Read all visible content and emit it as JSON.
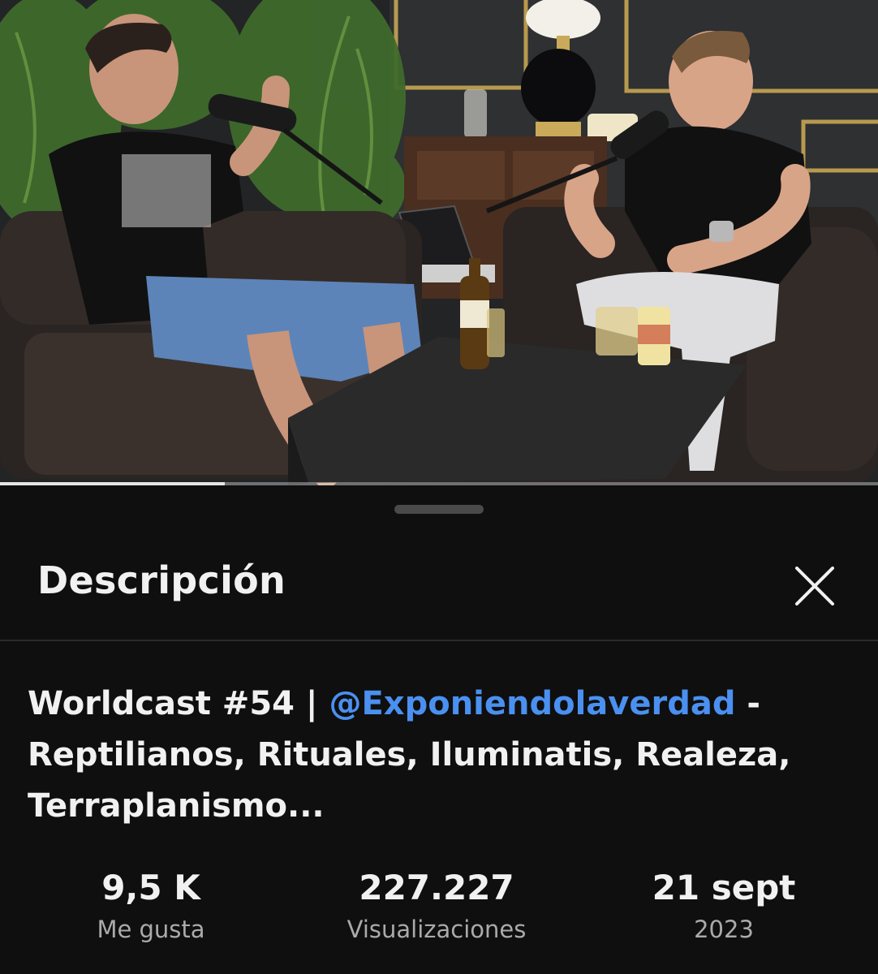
{
  "video": {
    "progress_fraction": 0.256,
    "scene_description_icon": "podcast-scene"
  },
  "sheet": {
    "title": "Descripción",
    "close_icon": "close-icon"
  },
  "video_info": {
    "title_prefix": "Worldcast #54 | ",
    "channel_mention": "@Exponiendolaverdad",
    "title_suffix": " - Reptilianos, Rituales, Iluminatis, Realeza, Terraplanismo..."
  },
  "stats": {
    "likes_value": "9,5 K",
    "likes_label": "Me gusta",
    "views_value": "227.227",
    "views_label": "Visualizaciones",
    "date_value": "21 sept",
    "date_year": "2023"
  },
  "colors": {
    "accent_link": "#4a90f0",
    "sheet_background": "#0f0f0f",
    "secondary_text": "#aaaaaa"
  }
}
